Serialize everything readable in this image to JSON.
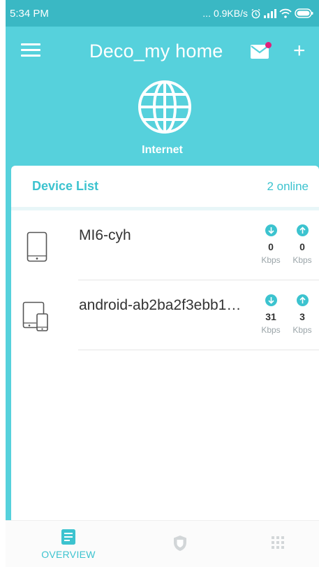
{
  "status_bar": {
    "time": "5:34 PM",
    "dots": "...",
    "speed": "0.9KB/s",
    "icons": [
      "alarm-icon",
      "signal-icon",
      "wifi-icon",
      "battery-icon"
    ]
  },
  "app_bar": {
    "title": "Deco_my home",
    "icons": [
      "menu-icon",
      "mail-icon",
      "add-icon"
    ],
    "notification_color": "#e0207a"
  },
  "internet": {
    "label": "Internet",
    "icon": "globe-icon"
  },
  "device_list": {
    "title": "Device List",
    "online_count": "2 online",
    "devices": [
      {
        "name": "MI6-cyh",
        "icon": "phone-icon",
        "download": "0",
        "upload": "0",
        "unit": "Kbps"
      },
      {
        "name": "android-ab2ba2f3ebb1…",
        "icon": "phone-tablet-icon",
        "download": "31",
        "upload": "3",
        "unit": "Kbps"
      }
    ]
  },
  "bottom_nav": {
    "items": [
      {
        "label": "OVERVIEW",
        "icon": "overview-icon",
        "active": true
      },
      {
        "label": "",
        "icon": "shield-icon",
        "active": false
      },
      {
        "label": "",
        "icon": "grid-icon",
        "active": false
      }
    ]
  },
  "colors": {
    "accent": "#3cc3cf",
    "background": "#56d1dc",
    "status_bar": "#3ab8c4"
  }
}
